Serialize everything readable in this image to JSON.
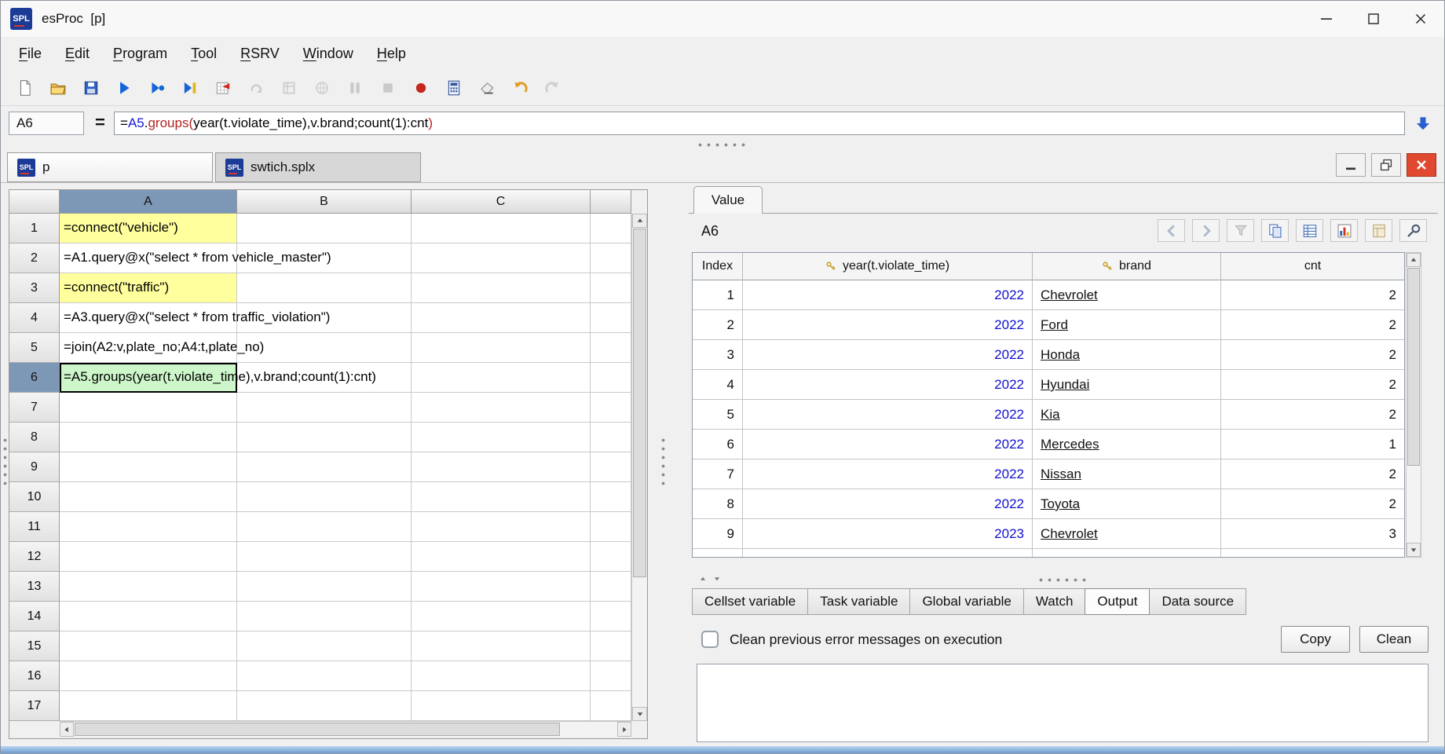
{
  "window": {
    "logo_text": "SPL",
    "title": "esProc  [p]",
    "controls": [
      "minimize",
      "maximize",
      "close"
    ],
    "mdi_controls": [
      "minimize",
      "restore",
      "close"
    ]
  },
  "menu_items": [
    "File",
    "Edit",
    "Program",
    "Tool",
    "RSRV",
    "Window",
    "Help"
  ],
  "toolbar": {
    "icons": [
      {
        "name": "new-file",
        "disabled": false
      },
      {
        "name": "open-file",
        "disabled": false
      },
      {
        "name": "save-file",
        "disabled": false
      },
      {
        "name": "execute",
        "disabled": false
      },
      {
        "name": "execute-debug",
        "disabled": false
      },
      {
        "name": "step-execute",
        "disabled": false
      },
      {
        "name": "set-breakpoint",
        "disabled": false
      },
      {
        "name": "calc-locked",
        "disabled": true
      },
      {
        "name": "calc-area",
        "disabled": true
      },
      {
        "name": "search-web",
        "disabled": true
      },
      {
        "name": "pause",
        "disabled": true
      },
      {
        "name": "stop",
        "disabled": true
      },
      {
        "name": "interrupt",
        "disabled": false
      },
      {
        "name": "calculator",
        "disabled": false
      },
      {
        "name": "clear-cells",
        "disabled": false
      },
      {
        "name": "undo",
        "disabled": false
      },
      {
        "name": "redo",
        "disabled": true
      }
    ]
  },
  "formula_bar": {
    "cell_ref": "A6",
    "equals_label": "=",
    "segments": [
      {
        "text": "=",
        "color": "#000000"
      },
      {
        "text": "A5",
        "color": "#1616d6"
      },
      {
        "text": ".",
        "color": "#000000"
      },
      {
        "text": "groups(",
        "color": "#b22222"
      },
      {
        "text": "year(t.violate_time),v.brand;count(1):cnt",
        "color": "#000000"
      },
      {
        "text": ")",
        "color": "#b22222"
      }
    ]
  },
  "file_tabs": [
    {
      "label": "p",
      "active": true
    },
    {
      "label": "swtich.splx",
      "active": false
    }
  ],
  "grid": {
    "column_headers": [
      "A",
      "B",
      "C",
      ""
    ],
    "row_count": 17,
    "selected_column": "A",
    "selected_row": 6,
    "cells": [
      {
        "row": 1,
        "col": "A",
        "text": "=connect(\"vehicle\")",
        "style": "yellow"
      },
      {
        "row": 2,
        "col": "A",
        "text": "=A1.query@x(\"select * from vehicle_master\")",
        "style": "normal"
      },
      {
        "row": 3,
        "col": "A",
        "text": "=connect(\"traffic\")",
        "style": "yellow"
      },
      {
        "row": 4,
        "col": "A",
        "text": "=A3.query@x(\"select * from traffic_violation\")",
        "style": "normal"
      },
      {
        "row": 5,
        "col": "A",
        "text": "=join(A2:v,plate_no;A4:t,plate_no)",
        "style": "normal"
      },
      {
        "row": 6,
        "col": "A",
        "text": "=A5.groups(year(t.violate_time),v.brand;count(1):cnt)",
        "style": "selected"
      }
    ]
  },
  "value_panel": {
    "tab_label": "Value",
    "cell_label": "A6",
    "icons": [
      {
        "name": "nav-back",
        "disabled": true
      },
      {
        "name": "nav-forward",
        "disabled": true
      },
      {
        "name": "filter",
        "disabled": true
      },
      {
        "name": "copy-data",
        "disabled": false
      },
      {
        "name": "text-view",
        "disabled": false
      },
      {
        "name": "chart-view",
        "disabled": false
      },
      {
        "name": "sheet-view",
        "disabled": true
      },
      {
        "name": "drill",
        "disabled": false
      }
    ],
    "table": {
      "columns": [
        {
          "label": "Index",
          "key": false
        },
        {
          "label": "year(t.violate_time)",
          "key": true
        },
        {
          "label": "brand",
          "key": true
        },
        {
          "label": "cnt",
          "key": false
        }
      ],
      "rows": [
        [
          1,
          2022,
          "Chevrolet",
          2
        ],
        [
          2,
          2022,
          "Ford",
          2
        ],
        [
          3,
          2022,
          "Honda",
          2
        ],
        [
          4,
          2022,
          "Hyundai",
          2
        ],
        [
          5,
          2022,
          "Kia",
          2
        ],
        [
          6,
          2022,
          "Mercedes",
          1
        ],
        [
          7,
          2022,
          "Nissan",
          2
        ],
        [
          8,
          2022,
          "Toyota",
          2
        ],
        [
          9,
          2023,
          "Chevrolet",
          3
        ]
      ]
    }
  },
  "bottom_tabs": [
    {
      "label": "Cellset variable",
      "active": false
    },
    {
      "label": "Task variable",
      "active": false
    },
    {
      "label": "Global variable",
      "active": false
    },
    {
      "label": "Watch",
      "active": false
    },
    {
      "label": "Output",
      "active": true
    },
    {
      "label": "Data source",
      "active": false
    }
  ],
  "output_panel": {
    "checkbox_label": "Clean previous error messages on execution",
    "checkbox_checked": false,
    "copy_label": "Copy",
    "clean_label": "Clean"
  }
}
